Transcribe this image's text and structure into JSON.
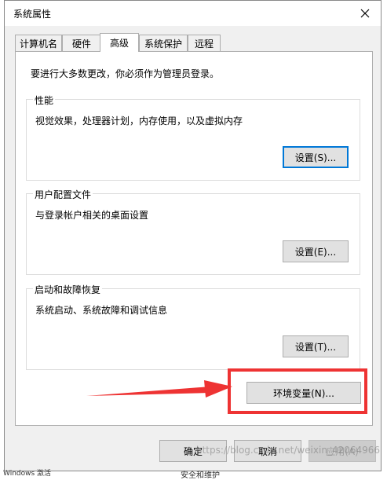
{
  "window": {
    "title": "系统属性",
    "close_label": "✕"
  },
  "tabs": [
    {
      "label": "计算机名",
      "active": false
    },
    {
      "label": "硬件",
      "active": false
    },
    {
      "label": "高级",
      "active": true
    },
    {
      "label": "系统保护",
      "active": false
    },
    {
      "label": "远程",
      "active": false
    }
  ],
  "advanced": {
    "admin_note": "要进行大多数更改，你必须作为管理员登录。",
    "performance": {
      "title": "性能",
      "description": "视觉效果，处理器计划，内存使用，以及虚拟内存",
      "button": "设置(S)..."
    },
    "user_profiles": {
      "title": "用户配置文件",
      "description": "与登录帐户相关的桌面设置",
      "button": "设置(E)..."
    },
    "startup_recovery": {
      "title": "启动和故障恢复",
      "description": "系统启动、系统故障和调试信息",
      "button": "设置(T)..."
    },
    "env_button": "环境变量(N)..."
  },
  "footer": {
    "ok": "确定",
    "cancel": "取消",
    "apply": "应用(A)"
  },
  "annotation": {
    "highlight_color": "#ee3333"
  },
  "watermark": "https://blog.csdn.net/weixin_42064966",
  "background": {
    "taskbar_text": "Windows 激活",
    "bottom_text": "安全和维护"
  }
}
